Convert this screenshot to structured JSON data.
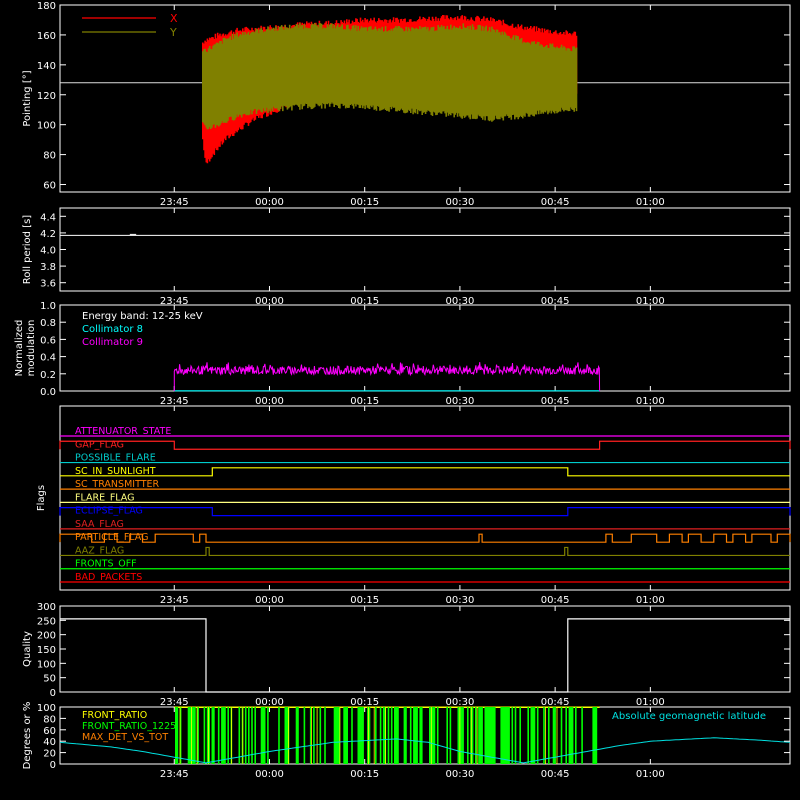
{
  "time_ticks": {
    "values": [
      -15,
      0,
      15,
      30,
      45,
      60
    ],
    "labels": [
      "23:45",
      "00:00",
      "00:15",
      "00:30",
      "00:45",
      "01:00"
    ]
  },
  "time_range": [
    -33,
    82
  ],
  "chart_data": [
    {
      "id": "pointing",
      "type": "line",
      "title": "",
      "xlabel": "",
      "ylabel": "Pointing [°]",
      "ylim": [
        55,
        180
      ],
      "yticks": [
        60,
        80,
        100,
        120,
        140,
        160,
        180
      ],
      "legend_position": "top-left",
      "reference_line": 128,
      "series": [
        {
          "name": "X",
          "color": "#ff0000",
          "x": [
            -10.5,
            -10,
            -9,
            -8,
            -7,
            -5,
            -3,
            0,
            5,
            10,
            15,
            20,
            25,
            30,
            35,
            40,
            45,
            47,
            48.5
          ],
          "upper": [
            155,
            157,
            158,
            160,
            161,
            163,
            164,
            165,
            167,
            168,
            170,
            170,
            171,
            172,
            170,
            165,
            162,
            161,
            161
          ],
          "lower": [
            90,
            73,
            80,
            85,
            90,
            96,
            102,
            108,
            116,
            120,
            122,
            122,
            123,
            124,
            122,
            118,
            116,
            118,
            120
          ]
        },
        {
          "name": "Y",
          "color": "#808000",
          "x": [
            -10.5,
            -10,
            -9,
            -8,
            -7,
            -5,
            -3,
            0,
            5,
            10,
            15,
            20,
            25,
            30,
            35,
            40,
            45,
            47,
            48.5
          ],
          "upper": [
            150,
            150,
            152,
            154,
            157,
            160,
            162,
            164,
            166,
            166,
            164,
            164,
            164,
            166,
            164,
            156,
            152,
            151,
            150
          ],
          "lower": [
            100,
            97,
            99,
            100,
            102,
            106,
            108,
            110,
            112,
            113,
            112,
            110,
            108,
            106,
            104,
            106,
            109,
            110,
            110
          ]
        }
      ]
    },
    {
      "id": "roll",
      "type": "line",
      "title": "",
      "xlabel": "",
      "ylabel": "Roll period [s]",
      "ylim": [
        3.5,
        4.5
      ],
      "yticks": [
        3.6,
        3.8,
        4.0,
        4.2,
        4.4
      ],
      "series": [
        {
          "color": "#ffffff",
          "x": [
            -33,
            82
          ],
          "y": [
            4.17,
            4.17
          ]
        }
      ]
    },
    {
      "id": "modulation",
      "type": "line",
      "title": "",
      "xlabel": "",
      "ylabel": "Normalized modulation",
      "ylim": [
        0,
        1.0
      ],
      "yticks": [
        0.0,
        0.2,
        0.4,
        0.6,
        0.8,
        1.0
      ],
      "legend_position": "top-left",
      "annotation": "Energy band: 12-25 keV",
      "series": [
        {
          "name": "Collimator 8",
          "color": "#00ffff",
          "x": [
            -15,
            52
          ],
          "y": [
            0.0,
            0.0
          ]
        },
        {
          "name": "Collimator 9",
          "color": "#ff00ff",
          "x": [
            -15,
            52
          ],
          "mean": 0.24,
          "spread": 0.05
        }
      ]
    },
    {
      "id": "flags",
      "type": "line",
      "title": "",
      "xlabel": "",
      "ylabel": "Flags",
      "flags": [
        {
          "name": "ATTENUATOR_STATE",
          "color": "#ff00ff",
          "on": []
        },
        {
          "name": "GAP_FLAG",
          "color": "#ff2020",
          "on": [
            [
              -33,
              -15
            ],
            [
              52,
              82
            ]
          ]
        },
        {
          "name": "POSSIBLE_FLARE",
          "color": "#00cccc",
          "on": []
        },
        {
          "name": "SC_IN_SUNLIGHT",
          "color": "#ffff00",
          "on": [
            [
              -9,
              47
            ]
          ]
        },
        {
          "name": "SC_TRANSMITTER",
          "color": "#ff8000",
          "on": []
        },
        {
          "name": "FLARE_FLAG",
          "color": "#ffff80",
          "on": []
        },
        {
          "name": "ECLIPSE_FLAG",
          "color": "#0000ff",
          "on": [
            [
              -33,
              -9
            ],
            [
              47,
              82
            ]
          ]
        },
        {
          "name": "SAA_FLAG",
          "color": "#e02020",
          "on": []
        },
        {
          "name": "PARTICLE_FLAG",
          "color": "#ff8000",
          "on": [
            [
              -33,
              -28
            ],
            [
              -26,
              -24
            ],
            [
              -22,
              -20
            ],
            [
              -18,
              -12
            ],
            [
              -11,
              -10
            ],
            [
              33,
              33.5
            ],
            [
              53,
              54
            ],
            [
              57,
              61
            ],
            [
              63,
              65
            ],
            [
              66,
              68
            ],
            [
              70,
              72
            ],
            [
              73,
              75
            ],
            [
              76,
              79
            ],
            [
              80,
              82
            ]
          ]
        },
        {
          "name": "AAZ_FLAG",
          "color": "#808000",
          "on": [
            [
              -10,
              -9.5
            ],
            [
              46.5,
              47
            ]
          ]
        },
        {
          "name": "FRONTS_OFF",
          "color": "#00ff00",
          "on": []
        },
        {
          "name": "BAD_PACKETS",
          "color": "#ff0000",
          "on": []
        }
      ]
    },
    {
      "id": "quality",
      "type": "line",
      "title": "",
      "xlabel": "",
      "ylabel": "Quality",
      "ylim": [
        0,
        300
      ],
      "yticks": [
        0,
        50,
        100,
        150,
        200,
        250,
        300
      ],
      "series": [
        {
          "color": "#ffffff",
          "x": [
            -33,
            -10,
            -10,
            47,
            47,
            82
          ],
          "y": [
            255,
            255,
            0,
            0,
            255,
            255
          ]
        }
      ]
    },
    {
      "id": "ratios",
      "type": "line",
      "title": "",
      "xlabel": "",
      "ylabel": "Degrees or %",
      "ylim": [
        0,
        100
      ],
      "yticks": [
        0,
        20,
        40,
        60,
        80,
        100
      ],
      "legend_position": "top-left",
      "right_label": "Absolute geomagnetic latitude",
      "series": [
        {
          "name": "FRONT_RATIO",
          "color": "#ffff00",
          "x": [
            -15,
            52
          ],
          "y": [
            100,
            100
          ]
        },
        {
          "name": "FRONT_RATIO_1225",
          "color": "#00ff00",
          "x": [
            -15,
            52
          ],
          "y": [
            100,
            100
          ]
        },
        {
          "name": "MAX_DET_VS_TOT",
          "color": "#ff8000",
          "x": [],
          "y": []
        },
        {
          "name": "Absolute geomagnetic latitude",
          "color": "#00e0e0",
          "x": [
            -33,
            -25,
            -20,
            -15,
            -10,
            -5,
            0,
            10,
            20,
            25,
            30,
            40,
            45,
            50,
            55,
            60,
            70,
            77,
            82
          ],
          "y": [
            38,
            30,
            22,
            12,
            2,
            12,
            22,
            38,
            44,
            38,
            22,
            2,
            12,
            22,
            32,
            40,
            46,
            42,
            38
          ]
        }
      ]
    }
  ]
}
